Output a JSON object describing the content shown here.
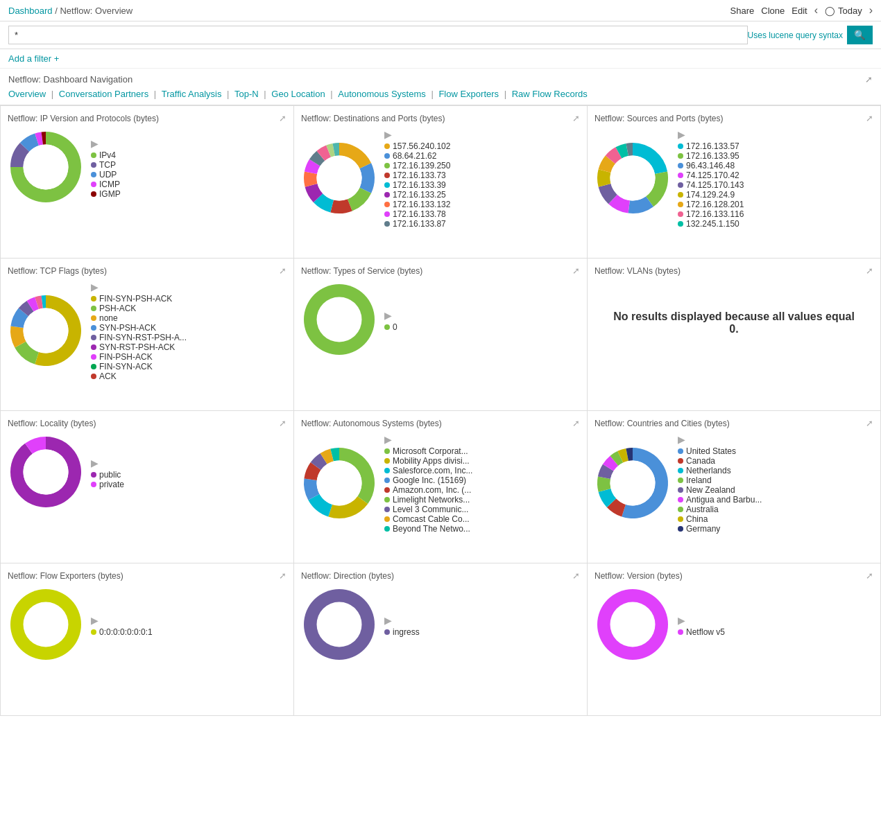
{
  "breadcrumb": {
    "dashboard": "Dashboard",
    "separator": "/",
    "current": "Netflow: Overview"
  },
  "topActions": {
    "share": "Share",
    "clone": "Clone",
    "edit": "Edit",
    "today": "Today"
  },
  "searchBar": {
    "value": "*",
    "placeholder": "*",
    "luceneHint": "Uses lucene query syntax"
  },
  "filterBar": {
    "addFilter": "Add a filter +"
  },
  "navPanel": {
    "title": "Netflow: Dashboard Navigation",
    "links": [
      {
        "label": "Overview",
        "href": "#"
      },
      {
        "label": "Conversation Partners",
        "href": "#"
      },
      {
        "label": "Traffic Analysis",
        "href": "#"
      },
      {
        "label": "Top-N",
        "href": "#"
      },
      {
        "label": "Geo Location",
        "href": "#"
      },
      {
        "label": "Autonomous Systems",
        "href": "#"
      },
      {
        "label": "Flow Exporters",
        "href": "#"
      },
      {
        "label": "Raw Flow Records",
        "href": "#"
      }
    ]
  },
  "panels": [
    {
      "id": "ip-version",
      "title": "Netflow: IP Version and Protocols (bytes)",
      "donut": {
        "segments": [
          {
            "color": "#7dc242",
            "pct": 75,
            "label": "IPv4"
          },
          {
            "color": "#6f5fa0",
            "pct": 12,
            "label": "TCP"
          },
          {
            "color": "#4a90d9",
            "pct": 8,
            "label": "UDP"
          },
          {
            "color": "#e040fb",
            "pct": 3,
            "label": "ICMP"
          },
          {
            "color": "#8b0000",
            "pct": 2,
            "label": "IGMP"
          }
        ],
        "size": 110,
        "inner": 65
      },
      "legend": [
        {
          "color": "#7dc242",
          "label": "IPv4"
        },
        {
          "color": "#6f5fa0",
          "label": "TCP"
        },
        {
          "color": "#4a90d9",
          "label": "UDP"
        },
        {
          "color": "#e040fb",
          "label": "ICMP"
        },
        {
          "color": "#8b0000",
          "label": "IGMP"
        }
      ]
    },
    {
      "id": "destinations-ports",
      "title": "Netflow: Destinations and Ports (bytes)",
      "donut": {
        "segments": [
          {
            "color": "#e6a817",
            "pct": 18
          },
          {
            "color": "#4a90d9",
            "pct": 14
          },
          {
            "color": "#7dc242",
            "pct": 12
          },
          {
            "color": "#c0392b",
            "pct": 10
          },
          {
            "color": "#00bcd4",
            "pct": 9
          },
          {
            "color": "#9c27b0",
            "pct": 8
          },
          {
            "color": "#ff7043",
            "pct": 7
          },
          {
            "color": "#e040fb",
            "pct": 6
          },
          {
            "color": "#607d8b",
            "pct": 5
          },
          {
            "color": "#f06292",
            "pct": 5
          },
          {
            "color": "#aed581",
            "pct": 3
          },
          {
            "color": "#4db6ac",
            "pct": 3
          }
        ],
        "size": 110,
        "inner": 65
      },
      "legend": [
        {
          "color": "#e6a817",
          "label": "157.56.240.102"
        },
        {
          "color": "#4a90d9",
          "label": "68.64.21.62"
        },
        {
          "color": "#7dc242",
          "label": "172.16.139.250"
        },
        {
          "color": "#c0392b",
          "label": "172.16.133.73"
        },
        {
          "color": "#00bcd4",
          "label": "172.16.133.39"
        },
        {
          "color": "#9c27b0",
          "label": "172.16.133.25"
        },
        {
          "color": "#ff7043",
          "label": "172.16.133.132"
        },
        {
          "color": "#e040fb",
          "label": "172.16.133.78"
        },
        {
          "color": "#607d8b",
          "label": "172.16.133.87"
        }
      ]
    },
    {
      "id": "sources-ports",
      "title": "Netflow: Sources and Ports (bytes)",
      "donut": {
        "segments": [
          {
            "color": "#00bcd4",
            "pct": 22
          },
          {
            "color": "#7dc242",
            "pct": 18
          },
          {
            "color": "#4a90d9",
            "pct": 12
          },
          {
            "color": "#e040fb",
            "pct": 10
          },
          {
            "color": "#6f5fa0",
            "pct": 9
          },
          {
            "color": "#c8b400",
            "pct": 8
          },
          {
            "color": "#e6a817",
            "pct": 7
          },
          {
            "color": "#f06292",
            "pct": 6
          },
          {
            "color": "#00bfa5",
            "pct": 5
          },
          {
            "color": "#607d8b",
            "pct": 3
          }
        ],
        "size": 110,
        "inner": 65
      },
      "legend": [
        {
          "color": "#00bcd4",
          "label": "172.16.133.57"
        },
        {
          "color": "#7dc242",
          "label": "172.16.133.95"
        },
        {
          "color": "#4a90d9",
          "label": "96.43.146.48"
        },
        {
          "color": "#e040fb",
          "label": "74.125.170.42"
        },
        {
          "color": "#6f5fa0",
          "label": "74.125.170.143"
        },
        {
          "color": "#c8b400",
          "label": "174.129.24.9"
        },
        {
          "color": "#e6a817",
          "label": "172.16.128.201"
        },
        {
          "color": "#f06292",
          "label": "172.16.133.116"
        },
        {
          "color": "#00bfa5",
          "label": "132.245.1.150"
        }
      ]
    },
    {
      "id": "tcp-flags",
      "title": "Netflow: TCP Flags (bytes)",
      "donut": {
        "segments": [
          {
            "color": "#c8b400",
            "pct": 55
          },
          {
            "color": "#7dc242",
            "pct": 12
          },
          {
            "color": "#e6a817",
            "pct": 10
          },
          {
            "color": "#4a90d9",
            "pct": 9
          },
          {
            "color": "#6f5fa0",
            "pct": 5
          },
          {
            "color": "#e040fb",
            "pct": 4
          },
          {
            "color": "#f06292",
            "pct": 3
          },
          {
            "color": "#00bcd4",
            "pct": 2
          }
        ],
        "size": 110,
        "inner": 65
      },
      "legend": [
        {
          "color": "#c8b400",
          "label": "FIN-SYN-PSH-ACK"
        },
        {
          "color": "#7dc242",
          "label": "PSH-ACK"
        },
        {
          "color": "#e6a817",
          "label": "none"
        },
        {
          "color": "#4a90d9",
          "label": "SYN-PSH-ACK"
        },
        {
          "color": "#6f5fa0",
          "label": "FIN-SYN-RST-PSH-A..."
        },
        {
          "color": "#9c27b0",
          "label": "SYN-RST-PSH-ACK"
        },
        {
          "color": "#e040fb",
          "label": "FIN-PSH-ACK"
        },
        {
          "color": "#00a651",
          "label": "FIN-SYN-ACK"
        },
        {
          "color": "#c0392b",
          "label": "ACK"
        }
      ]
    },
    {
      "id": "types-of-service",
      "title": "Netflow: Types of Service (bytes)",
      "donut": {
        "segments": [
          {
            "color": "#7dc242",
            "pct": 100
          }
        ],
        "size": 110,
        "inner": 65
      },
      "legend": [
        {
          "color": "#7dc242",
          "label": "0"
        }
      ]
    },
    {
      "id": "vlans",
      "title": "Netflow: VLANs (bytes)",
      "noResults": true,
      "noResultsText": "No results displayed because all values equal 0."
    },
    {
      "id": "locality",
      "title": "Netflow: Locality (bytes)",
      "donut": {
        "segments": [
          {
            "color": "#9c27b0",
            "pct": 90
          },
          {
            "color": "#e040fb",
            "pct": 10
          }
        ],
        "size": 110,
        "inner": 65
      },
      "legend": [
        {
          "color": "#9c27b0",
          "label": "public"
        },
        {
          "color": "#e040fb",
          "label": "private"
        }
      ]
    },
    {
      "id": "autonomous-systems",
      "title": "Netflow: Autonomous Systems (bytes)",
      "donut": {
        "segments": [
          {
            "color": "#7dc242",
            "pct": 35
          },
          {
            "color": "#c8b400",
            "pct": 20
          },
          {
            "color": "#00bcd4",
            "pct": 12
          },
          {
            "color": "#4a90d9",
            "pct": 10
          },
          {
            "color": "#c0392b",
            "pct": 8
          },
          {
            "color": "#6f5fa0",
            "pct": 6
          },
          {
            "color": "#e6a817",
            "pct": 5
          },
          {
            "color": "#00bfa5",
            "pct": 4
          }
        ],
        "size": 110,
        "inner": 65
      },
      "legend": [
        {
          "color": "#7dc242",
          "label": "Microsoft Corporat..."
        },
        {
          "color": "#c8b400",
          "label": "Mobility Apps divisi..."
        },
        {
          "color": "#00bcd4",
          "label": "Salesforce.com, Inc..."
        },
        {
          "color": "#4a90d9",
          "label": "Google Inc. (15169)"
        },
        {
          "color": "#c0392b",
          "label": "Amazon.com, Inc. (..."
        },
        {
          "color": "#7dc242",
          "label": "Limelight Networks..."
        },
        {
          "color": "#6f5fa0",
          "label": "Level 3 Communic..."
        },
        {
          "color": "#e6a817",
          "label": "Comcast Cable Co..."
        },
        {
          "color": "#00bfa5",
          "label": "Beyond The Netwo..."
        }
      ]
    },
    {
      "id": "countries-cities",
      "title": "Netflow: Countries and Cities (bytes)",
      "donut": {
        "segments": [
          {
            "color": "#4a90d9",
            "pct": 55
          },
          {
            "color": "#c0392b",
            "pct": 8
          },
          {
            "color": "#00bcd4",
            "pct": 8
          },
          {
            "color": "#7dc242",
            "pct": 7
          },
          {
            "color": "#6f5fa0",
            "pct": 6
          },
          {
            "color": "#e040fb",
            "pct": 5
          },
          {
            "color": "#7dc242",
            "pct": 4
          },
          {
            "color": "#c8b400",
            "pct": 4
          },
          {
            "color": "#273474",
            "pct": 3
          }
        ],
        "size": 110,
        "inner": 65
      },
      "legend": [
        {
          "color": "#4a90d9",
          "label": "United States"
        },
        {
          "color": "#c0392b",
          "label": "Canada"
        },
        {
          "color": "#00bcd4",
          "label": "Netherlands"
        },
        {
          "color": "#7dc242",
          "label": "Ireland"
        },
        {
          "color": "#6f5fa0",
          "label": "New Zealand"
        },
        {
          "color": "#e040fb",
          "label": "Antigua and Barbu..."
        },
        {
          "color": "#7dc242",
          "label": "Australia"
        },
        {
          "color": "#c8b400",
          "label": "China"
        },
        {
          "color": "#273474",
          "label": "Germany"
        }
      ]
    },
    {
      "id": "flow-exporters",
      "title": "Netflow: Flow Exporters (bytes)",
      "donut": {
        "segments": [
          {
            "color": "#c8d400",
            "pct": 100
          }
        ],
        "size": 110,
        "inner": 65
      },
      "legend": [
        {
          "color": "#c8d400",
          "label": "0:0:0:0:0:0:0:1"
        }
      ]
    },
    {
      "id": "direction",
      "title": "Netflow: Direction (bytes)",
      "donut": {
        "segments": [
          {
            "color": "#6f5fa0",
            "pct": 100
          }
        ],
        "size": 110,
        "inner": 65
      },
      "legend": [
        {
          "color": "#6f5fa0",
          "label": "ingress"
        }
      ]
    },
    {
      "id": "version",
      "title": "Netflow: Version (bytes)",
      "donut": {
        "segments": [
          {
            "color": "#e040fb",
            "pct": 100
          }
        ],
        "size": 110,
        "inner": 65
      },
      "legend": [
        {
          "color": "#e040fb",
          "label": "Netflow v5"
        }
      ]
    }
  ]
}
